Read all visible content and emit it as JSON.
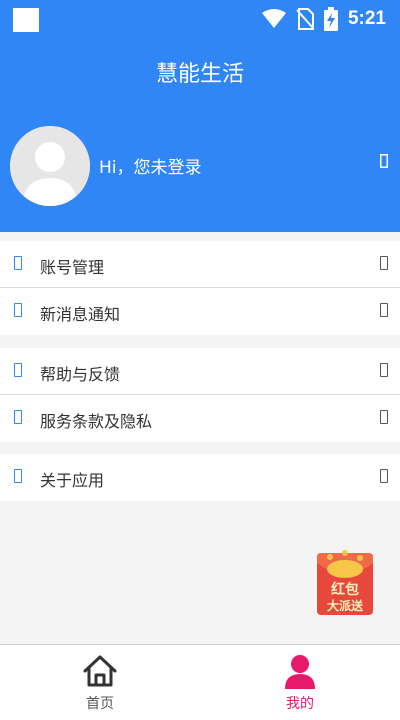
{
  "status_bar": {
    "time": "5:21"
  },
  "header": {
    "title": "慧能生活",
    "login_text": "Hi，您未登录"
  },
  "menu": {
    "group1": [
      {
        "label": "账号管理"
      },
      {
        "label": "新消息通知"
      }
    ],
    "group2": [
      {
        "label": "帮助与反馈"
      },
      {
        "label": "服务条款及隐私"
      }
    ],
    "group3": [
      {
        "label": "关于应用"
      }
    ]
  },
  "promo": {
    "line1": "红包",
    "line2": "大派送"
  },
  "tabbar": {
    "tabs": [
      {
        "label": "首页",
        "active": false
      },
      {
        "label": "我的",
        "active": true
      }
    ]
  },
  "colors": {
    "primary": "#2f86f4",
    "active_tab": "#e8186a",
    "background": "#f4f4f4"
  }
}
